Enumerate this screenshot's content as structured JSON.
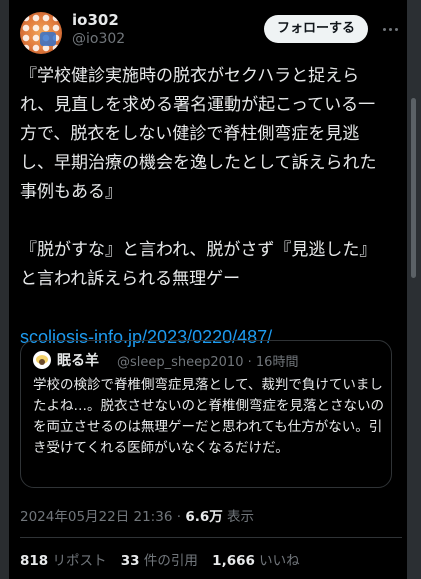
{
  "author": {
    "display_name": "io302",
    "handle": "@io302"
  },
  "follow_label": "フォローする",
  "tweet": {
    "paragraph1": "『学校健診実施時の脱衣がセクハラと捉えられ、見直しを求める署名運動が起こっている一方で、脱衣をしない健診で脊柱側弯症を見逃し、早期治療の機会を逸したとして訴えられた事例もある』",
    "paragraph2": "『脱がすな』と言われ、脱がさず『見逃した』と言われ訴えられる無理ゲー",
    "link": "scoliosis-info.jp/2023/0220/487/"
  },
  "quote": {
    "display_name": "眠る羊",
    "handle": "@sleep_sheep2010",
    "separator": "·",
    "time": "16時間",
    "text": "学校の検診で脊椎側弯症見落として、裁判で負けていましたよね…。脱衣させないのと脊椎側弯症を見落とさないのを両立させるのは無理ゲーだと思われても仕方がない。引き受けてくれる医師がいなくなるだけだ。"
  },
  "meta": {
    "datetime": "2024年05月22日 21:36",
    "separator": "·",
    "views_count": "6.6万",
    "views_label": "表示"
  },
  "stats": {
    "reposts_count": "818",
    "reposts_label": "リポスト",
    "quotes_count": "33",
    "quotes_label": "件の引用",
    "likes_count": "1,666",
    "likes_label": "いいね"
  },
  "colors": {
    "background": "#000000",
    "text": "#e7e9ea",
    "secondary": "#71767b",
    "link": "#1d9bf0",
    "border": "#2f3336",
    "follow_button_bg": "#eff3f4"
  },
  "icons": {
    "more": "more-horizontal-icon",
    "quote_avatar": "sheep-avatar"
  }
}
